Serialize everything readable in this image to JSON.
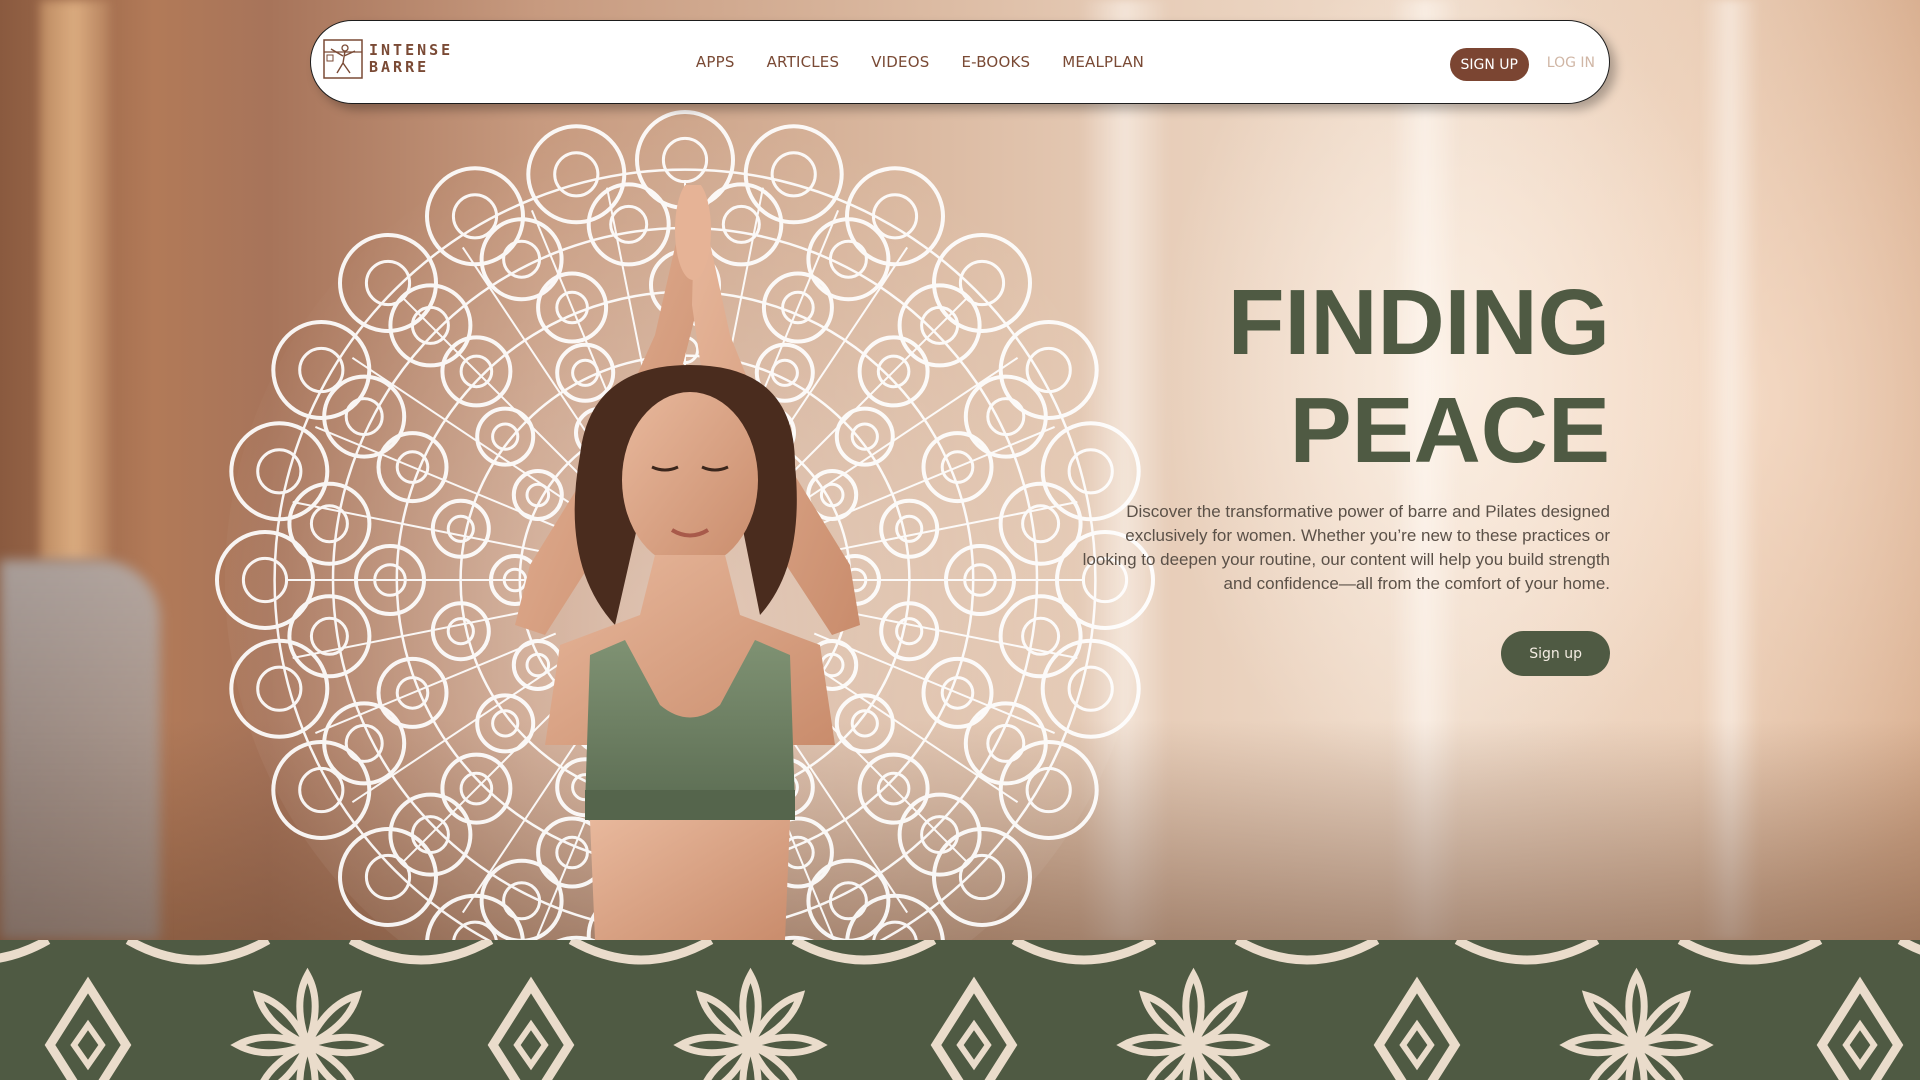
{
  "brand": {
    "line1": "INTENSE",
    "line2": "BARRE",
    "logo_icon": "barre-dancer-logo-icon"
  },
  "nav": {
    "links": [
      "APPS",
      "ARTICLES",
      "VIDEOS",
      "E-BOOKS",
      "MEALPLAN"
    ],
    "signup_label": "SIGN UP",
    "login_label": "LOG IN"
  },
  "hero": {
    "title_line1": "FINDING",
    "title_line2": "PEACE",
    "description": "Discover the transformative power of barre and Pilates designed exclusively for women. Whether you’re new to these practices or looking to deepen your routine, our content will help you build strength and confidence—all from the comfort of your home.",
    "cta_label": "Sign up",
    "image": "woman-yoga-pose-with-mandala"
  },
  "colors": {
    "accent_brown": "#7b4532",
    "accent_green": "#4f5a43",
    "pattern_cream": "#eadccb",
    "login_muted": "#d0b6a5"
  }
}
